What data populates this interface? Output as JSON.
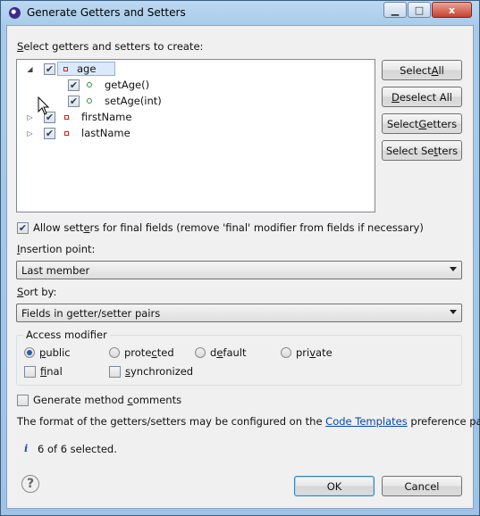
{
  "window": {
    "title": "Generate Getters and Setters"
  },
  "window_controls": {
    "minimize": "▁",
    "maximize": "□",
    "close": "x"
  },
  "labels": {
    "select_prompt": "Select getters and setters to create:",
    "select_prompt_mnemonic": "S",
    "select_prompt_rest": "elect getters and setters to create:",
    "allow_final_pre": "Allow sett",
    "allow_final_mn": "e",
    "allow_final_post": "rs for final fields (remove 'final' modifier from fields if necessary)",
    "insertion_point_mn": "I",
    "insertion_point_rest": "nsertion point:",
    "sort_by_mn": "S",
    "sort_by_rest": "ort by:",
    "access_modifier": "Access modifier",
    "generate_comments_pre": "Generate method ",
    "generate_comments_mn": "c",
    "generate_comments_post": "omments",
    "info_pre": "The format of the getters/setters may be configured on the ",
    "info_link": "Code Templates",
    "info_post": " preference page.",
    "selection_status": "6 of 6 selected."
  },
  "tree": [
    {
      "name": "age",
      "kind": "field",
      "checked": true,
      "expanded": true,
      "selected": true
    },
    {
      "name": "getAge()",
      "kind": "method",
      "checked": true
    },
    {
      "name": "setAge(int)",
      "kind": "method",
      "checked": true
    },
    {
      "name": "firstName",
      "kind": "field",
      "checked": true,
      "expanded": false
    },
    {
      "name": "lastName",
      "kind": "field",
      "checked": true,
      "expanded": false
    }
  ],
  "side_buttons": {
    "select_all_pre": "Select ",
    "select_all_mn": "A",
    "select_all_post": "ll",
    "deselect_all_pre": "",
    "deselect_all_mn": "D",
    "deselect_all_post": "eselect All",
    "select_getters_pre": "Select ",
    "select_getters_mn": "G",
    "select_getters_post": "etters",
    "select_setters_pre": "Select Se",
    "select_setters_mn": "t",
    "select_setters_post": "ters"
  },
  "insertion_point": {
    "value": "Last member"
  },
  "sort_by": {
    "value": "Fields in getter/setter pairs"
  },
  "access": {
    "public_mn": "p",
    "public_rest": "ublic",
    "protected_pre": "prote",
    "protected_mn": "c",
    "protected_post": "ted",
    "default_pre": "d",
    "default_mn": "e",
    "default_post": "fault",
    "private_pre": "pri",
    "private_mn": "v",
    "private_post": "ate",
    "final_pre": "",
    "final_mn": "f",
    "final_post": "inal",
    "sync_pre": "",
    "sync_mn": "s",
    "sync_post": "ynchronized",
    "selected": "public"
  },
  "footer": {
    "ok": "OK",
    "cancel": "Cancel"
  },
  "icons": {
    "info": "info-icon",
    "help": "help-icon"
  },
  "colors": {
    "titlebar": "#a9cbe9",
    "client": "#f0f0f0",
    "link": "#0645ad",
    "selection": "#dbe9fb"
  }
}
